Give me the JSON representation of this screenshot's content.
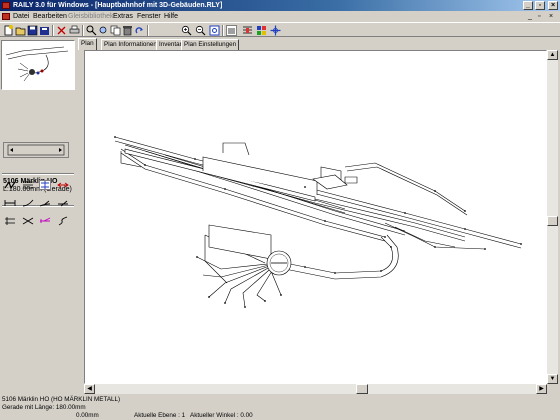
{
  "window": {
    "title": "RAILY 3.0 für Windows - [Hauptbahnhof mit 3D-Gebäuden.RLY]",
    "buttons": [
      "_",
      "▫",
      "×"
    ]
  },
  "menu": {
    "items": [
      {
        "label": "Datei",
        "disabled": false
      },
      {
        "label": "Bearbeiten",
        "disabled": false
      },
      {
        "label": "Gleisbibliothek",
        "disabled": true
      },
      {
        "label": "Extras",
        "disabled": false
      },
      {
        "label": "Fenster",
        "disabled": false
      },
      {
        "label": "Hilfe",
        "disabled": false
      }
    ],
    "mdi_buttons": [
      "_",
      "▫",
      "×"
    ]
  },
  "toolbar": {
    "icons": [
      "new-icon",
      "open-icon",
      "save-icon",
      "save-all-icon",
      "cut-icon",
      "print-icon",
      "find-icon",
      "zoom-view-icon",
      "copy-icon",
      "delete-icon",
      "redo-icon",
      "zoom-in-icon",
      "zoom-out-icon",
      "zoom-fit-icon",
      "3d-view-icon",
      "grid-icon",
      "layers-icon",
      "move-icon"
    ]
  },
  "left_panel": {
    "track_title": "5106 Märklin HO",
    "track_info": "L:180.00mm (Gerade)",
    "tool_icons": [
      "flex-track-icon",
      "straight-icon",
      "switch-icon",
      "arrow-icon",
      "bumper-icon",
      "curve-icon",
      "curve-left-icon",
      "curve-right-icon",
      "diamond-icon",
      "crossing-icon",
      "turnout-icon",
      "s-curve-icon"
    ]
  },
  "tabs": [
    {
      "label": "Plan",
      "active": true
    },
    {
      "label": "Plan Informationen",
      "active": false
    },
    {
      "label": "Inventar",
      "active": false
    },
    {
      "label": "Plan Einstellungen",
      "active": false
    }
  ],
  "status": {
    "line1": "5106 Märklin HO (HO MÄRKLIN METALL)",
    "line2": "Gerade mit Länge: 180.00mm",
    "coord": "0.00mm",
    "ebene": "Aktuelle Ebene : 1",
    "winkel": "Aktueller Winkel : 0.00"
  }
}
